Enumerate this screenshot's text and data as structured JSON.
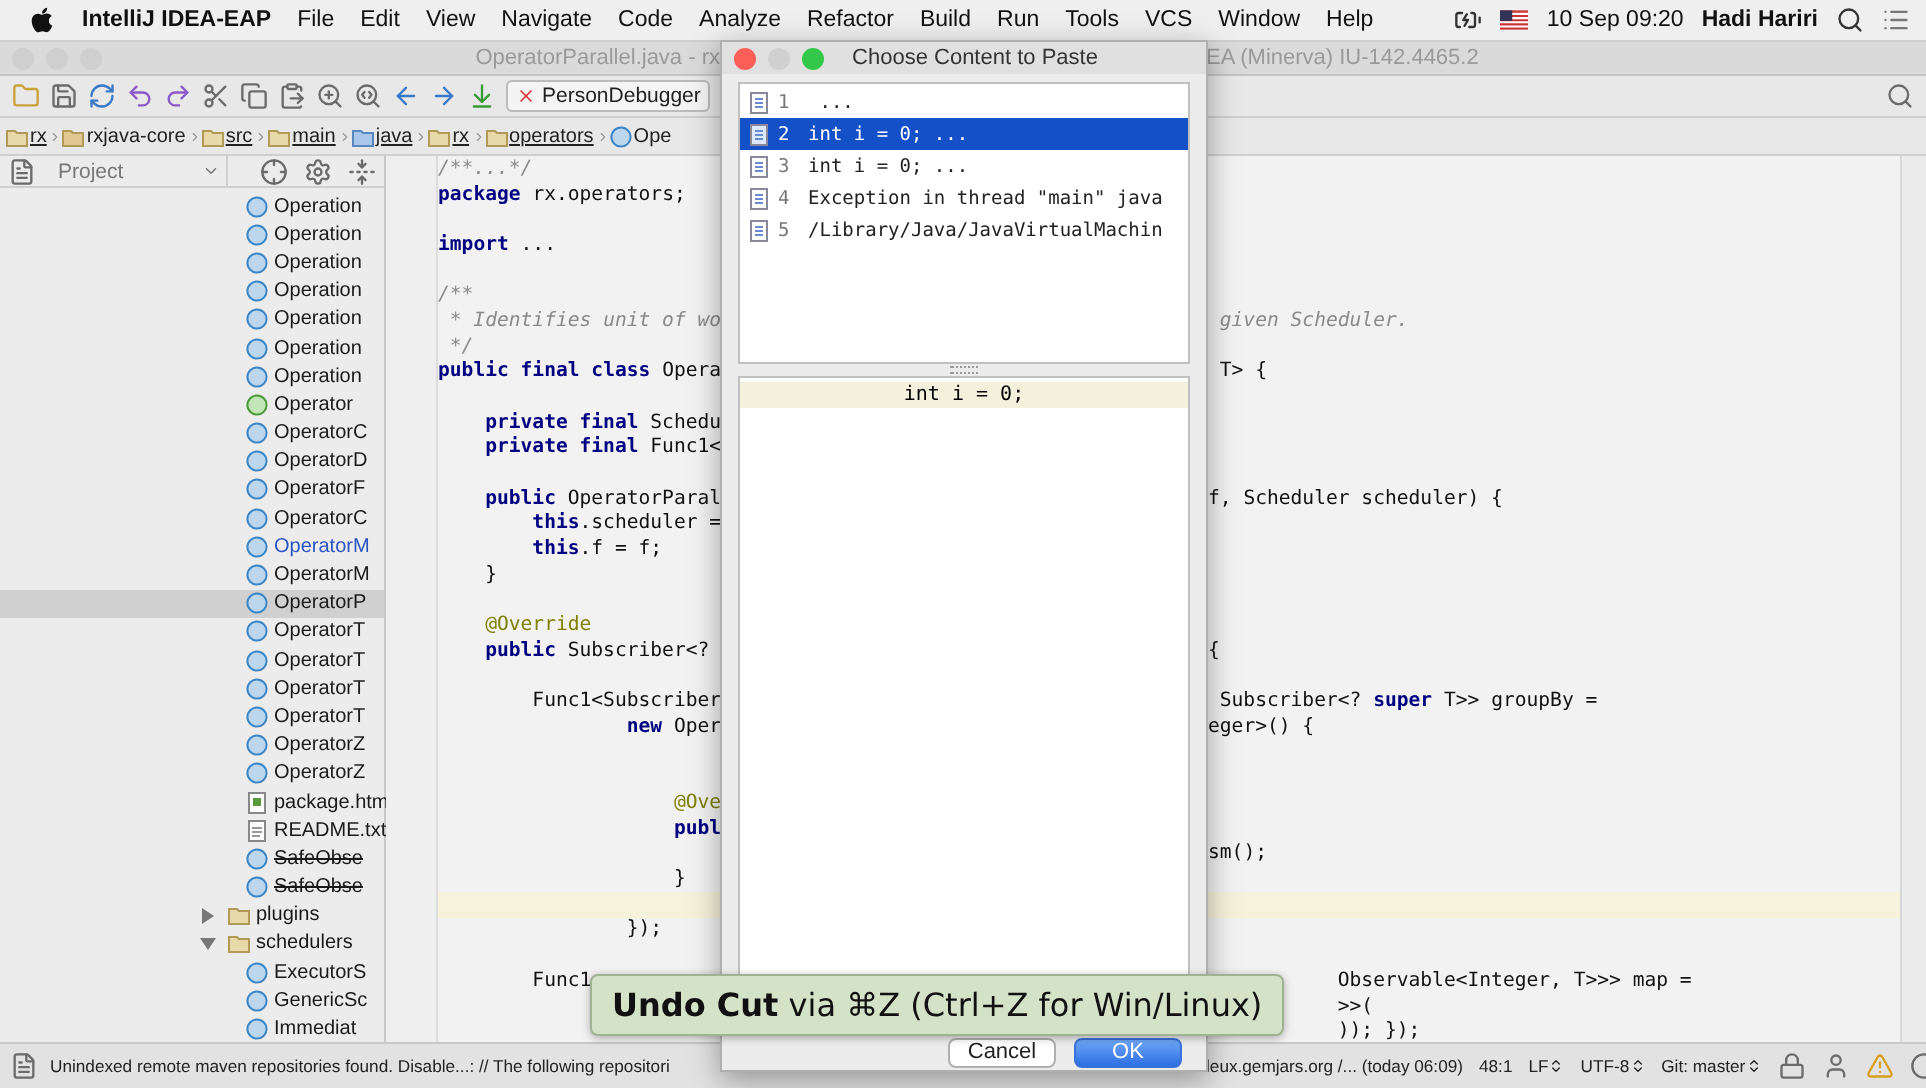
{
  "menu_bar": {
    "app_name": "IntelliJ IDEA-EAP",
    "menus": [
      "File",
      "Edit",
      "View",
      "Navigate",
      "Code",
      "Analyze",
      "Refactor",
      "Build",
      "Run",
      "Tools",
      "VCS",
      "Window",
      "Help"
    ],
    "clock": "10 Sep  09:20",
    "user": "Hadi Hariri"
  },
  "window": {
    "title_left": "OperatorParallel.java - rx",
    "title_right": "EA (Minerva) IU-142.4465.2"
  },
  "toolbar": {
    "run_config": "PersonDebugger"
  },
  "breadcrumbs": [
    {
      "label": "rx",
      "kind": "folder"
    },
    {
      "label": "rxjava-core",
      "kind": "module"
    },
    {
      "label": "src",
      "kind": "folder"
    },
    {
      "label": "main",
      "kind": "folder"
    },
    {
      "label": "java",
      "kind": "source"
    },
    {
      "label": "rx",
      "kind": "folder"
    },
    {
      "label": "operators",
      "kind": "folder"
    },
    {
      "label": "Ope",
      "kind": "class"
    }
  ],
  "project": {
    "title": "Project",
    "items": [
      {
        "label": "Operation",
        "kind": "class",
        "deprecated": false,
        "selected": false
      },
      {
        "label": "Operation",
        "kind": "class",
        "deprecated": false,
        "selected": false
      },
      {
        "label": "Operation",
        "kind": "class",
        "deprecated": false,
        "selected": false
      },
      {
        "label": "Operation",
        "kind": "class",
        "deprecated": false,
        "selected": false
      },
      {
        "label": "Operation",
        "kind": "class",
        "deprecated": false,
        "selected": false
      },
      {
        "label": "Operation",
        "kind": "class",
        "deprecated": false,
        "selected": false
      },
      {
        "label": "Operation",
        "kind": "class",
        "deprecated": false,
        "selected": false
      },
      {
        "label": "Operator",
        "kind": "interface",
        "deprecated": false,
        "selected": false
      },
      {
        "label": "OperatorC",
        "kind": "class",
        "deprecated": false,
        "selected": false
      },
      {
        "label": "OperatorD",
        "kind": "class",
        "deprecated": false,
        "selected": false
      },
      {
        "label": "OperatorF",
        "kind": "class",
        "deprecated": false,
        "selected": false
      },
      {
        "label": "OperatorC",
        "kind": "class",
        "deprecated": false,
        "selected": false
      },
      {
        "label": "OperatorM",
        "kind": "class",
        "deprecated": false,
        "modified": true,
        "selected": false
      },
      {
        "label": "OperatorM",
        "kind": "class",
        "deprecated": false,
        "modified": false,
        "selected": false
      },
      {
        "label": "OperatorP",
        "kind": "class",
        "deprecated": false,
        "selected": true
      },
      {
        "label": "OperatorT",
        "kind": "class",
        "deprecated": false,
        "selected": false
      },
      {
        "label": "OperatorT",
        "kind": "class",
        "deprecated": false,
        "selected": false
      },
      {
        "label": "OperatorT",
        "kind": "class",
        "deprecated": false,
        "selected": false
      },
      {
        "label": "OperatorT",
        "kind": "class",
        "deprecated": false,
        "selected": false
      },
      {
        "label": "OperatorZ",
        "kind": "class",
        "deprecated": false,
        "selected": false
      },
      {
        "label": "OperatorZ",
        "kind": "class",
        "deprecated": false,
        "selected": false
      },
      {
        "label": "package.htm",
        "kind": "html",
        "deprecated": false,
        "selected": false
      },
      {
        "label": "README.txt",
        "kind": "text",
        "deprecated": false,
        "selected": false
      },
      {
        "label": "SafeObse",
        "kind": "class",
        "deprecated": true,
        "selected": false
      },
      {
        "label": "SafeObse",
        "kind": "class",
        "deprecated": true,
        "selected": false
      },
      {
        "label": "plugins",
        "kind": "folder",
        "deprecated": false,
        "selected": false,
        "expanded": false
      },
      {
        "label": "schedulers",
        "kind": "folder",
        "deprecated": false,
        "selected": false,
        "expanded": true,
        "children": [
          {
            "label": "ExecutorS",
            "kind": "class",
            "deprecated": false,
            "selected": false
          },
          {
            "label": "GenericSc",
            "kind": "class",
            "deprecated": false,
            "selected": false
          },
          {
            "label": "Immediat",
            "kind": "class",
            "deprecated": false,
            "selected": false
          }
        ]
      }
    ]
  },
  "editor": {
    "lines": [
      {
        "text": "/**...*/",
        "kind": "comment",
        "current": false
      },
      {
        "text": "**package** rx.operators;",
        "kind": "code",
        "current": false
      },
      {
        "kind": "code",
        "current": false
      },
      {
        "text": "**import** ...",
        "kind": "code",
        "current": false
      },
      {
        "kind": "code",
        "current": false
      },
      {
        "text": "/**",
        "kind": "comment",
        "current": false
      },
      {
        "text": " * Identifies unit of wo",
        "right": " given Scheduler.",
        "kind": "comment",
        "current": false
      },
      {
        "text": " */",
        "kind": "comment",
        "current": false
      },
      {
        "text": "**public final class** Opera",
        "right": " T> {",
        "kind": "code",
        "current": false
      },
      {
        "kind": "code",
        "current": false
      },
      {
        "text": "    **private final** Schedu",
        "kind": "code",
        "current": false
      },
      {
        "text": "    **private final** Func1<",
        "kind": "code",
        "current": false
      },
      {
        "kind": "code",
        "current": false
      },
      {
        "text": "    **public** OperatorParal",
        "right": "f, Scheduler scheduler) {",
        "kind": "code",
        "current": false
      },
      {
        "text": "        **this**.scheduler =",
        "kind": "code",
        "current": false
      },
      {
        "text": "        **this**.f = f;",
        "kind": "code",
        "current": false
      },
      {
        "text": "    }",
        "kind": "code",
        "current": false
      },
      {
        "kind": "code",
        "current": false
      },
      {
        "text": "    @Override",
        "kind": "annotation",
        "current": false
      },
      {
        "text": "    **public** Subscriber<?",
        "right": "{",
        "kind": "code",
        "current": false
      },
      {
        "kind": "code",
        "current": false
      },
      {
        "text": "        Func1<Subscriber",
        "right": " Subscriber<? **super** T>> groupBy =",
        "kind": "code",
        "current": false
      },
      {
        "text": "                **new** Oper",
        "right": "eger>() {",
        "kind": "code",
        "current": false
      },
      {
        "kind": "code",
        "current": false
      },
      {
        "kind": "code",
        "current": false
      },
      {
        "text": "                    @Ove",
        "kind": "annotation",
        "current": false
      },
      {
        "text": "                    **publ**",
        "kind": "code",
        "current": false
      },
      {
        "right": "sm();",
        "kind": "code",
        "current": false
      },
      {
        "text": "                    }",
        "kind": "code",
        "current": false
      },
      {
        "kind": "code",
        "current": true
      },
      {
        "text": "                });",
        "kind": "code",
        "current": false
      },
      {
        "kind": "code",
        "current": false
      },
      {
        "text": "        Func1",
        "right": "           Observable<Integer, T>>> map =",
        "kind": "code",
        "current": false
      },
      {
        "right": "           >>(",
        "kind": "code",
        "current": false
      },
      {
        "right": "           )); });",
        "kind": "code",
        "current": false
      }
    ]
  },
  "dialog": {
    "title": "Choose Content to Paste",
    "items": [
      {
        "number": "1",
        "text": " ...",
        "selected": false
      },
      {
        "number": "2",
        "text": "int i = 0; ...",
        "selected": true
      },
      {
        "number": "3",
        "text": "int i = 0; ...",
        "selected": false
      },
      {
        "number": "4",
        "text": "Exception in thread \"main\" java",
        "selected": false
      },
      {
        "number": "5",
        "text": "/Library/Java/JavaVirtualMachin",
        "selected": false
      }
    ],
    "preview": "int i = 0;",
    "buttons": [
      {
        "label": "Cancel",
        "default": false
      },
      {
        "label": "OK",
        "default": true
      }
    ]
  },
  "tooltip": "**Undo Cut** via ⌘Z (Ctrl+Z for Win/Linux)",
  "status_bar": {
    "message": "Unindexed remote maven repositories found. Disable...: // The following repositori",
    "items": [
      {
        "text": "leux.gemjars.org /... (today 06:09)",
        "dropdown": false
      },
      {
        "text": "48:1",
        "dropdown": false
      },
      {
        "text": "LF",
        "dropdown": true
      },
      {
        "text": "UTF-8",
        "dropdown": true
      },
      {
        "text": "Git: master",
        "dropdown": true
      }
    ]
  }
}
